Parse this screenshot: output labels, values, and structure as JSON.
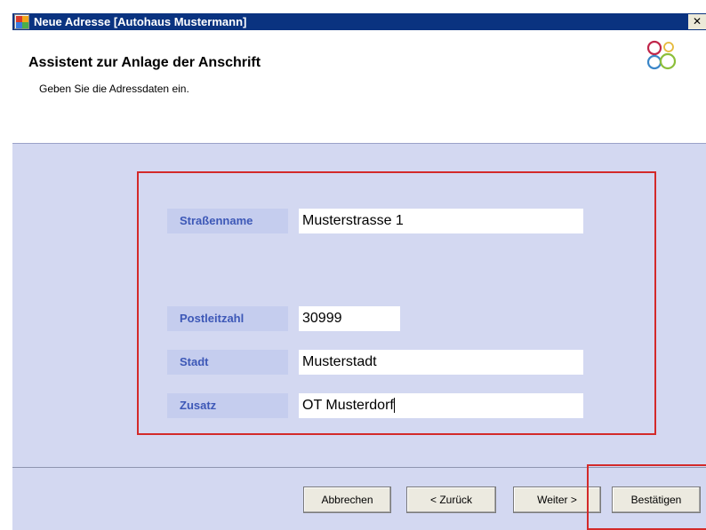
{
  "window": {
    "title": "Neue Adresse [Autohaus Mustermann]",
    "close_glyph": "✕"
  },
  "header": {
    "heading": "Assistent zur Anlage der Anschrift",
    "subheading": "Geben Sie die Adressdaten ein.",
    "logo_icon": "circles-logo-icon"
  },
  "form": {
    "street": {
      "label": "Straßenname",
      "value": "Musterstrasse 1"
    },
    "postal": {
      "label": "Postleitzahl",
      "value": "30999"
    },
    "city": {
      "label": "Stadt",
      "value": "Musterstadt"
    },
    "extra": {
      "label": "Zusatz",
      "value": "OT Musterdorf"
    }
  },
  "buttons": {
    "cancel": "Abbrechen",
    "back": "< Zurück",
    "next": "Weiter >",
    "confirm": "Bestätigen"
  },
  "colors": {
    "titlebar": "#0a3380",
    "content_bg": "#d3d8f1",
    "label_bg": "#c5cdee",
    "label_text": "#3d58b7",
    "highlight_red": "#d32a2a"
  }
}
